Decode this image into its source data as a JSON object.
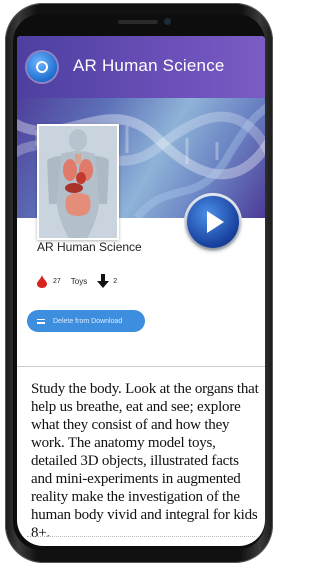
{
  "header": {
    "title": "AR Human Science"
  },
  "app": {
    "name": "AR Human Science",
    "likes": "27",
    "category": "Toys",
    "downloads": "2",
    "delete_label": "Delete from Download",
    "play_icon": "play-icon"
  },
  "description": "Study the body. Look at the organs that help us breathe, eat and see; explore what they consist of and how they work. The anatomy model toys, detailed 3D objects, illustrated facts and mini-experiments in augmented reality make the investigation of the human body vivid and integral for kids 8+.",
  "colors": {
    "header": "#5a47ab",
    "accent": "#3e8ee0",
    "play": "#173f9c",
    "heart": "#d8241f"
  }
}
